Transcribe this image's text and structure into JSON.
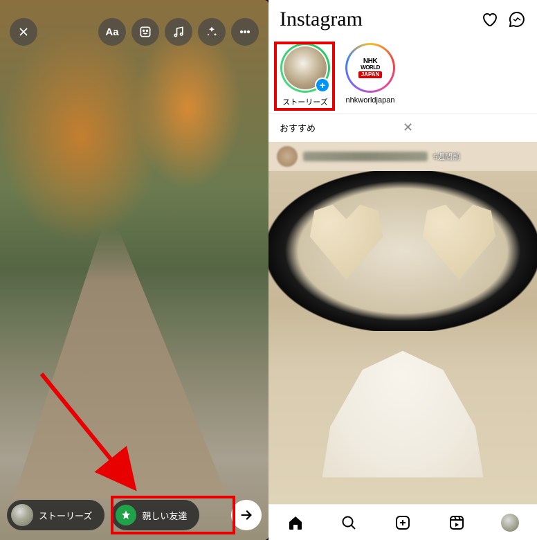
{
  "left": {
    "bottom": {
      "stories_label": "ストーリーズ",
      "close_friends_label": "親しい友達"
    }
  },
  "right": {
    "logo": "Instagram",
    "stories": [
      {
        "label": "ストーリーズ"
      },
      {
        "label": "nhkworldjapan",
        "nhk_line1": "NHK",
        "nhk_line2": "WORLD",
        "nhk_line3": "JAPAN"
      }
    ],
    "suggest_label": "おすすめ",
    "post_time": "5週間前"
  }
}
